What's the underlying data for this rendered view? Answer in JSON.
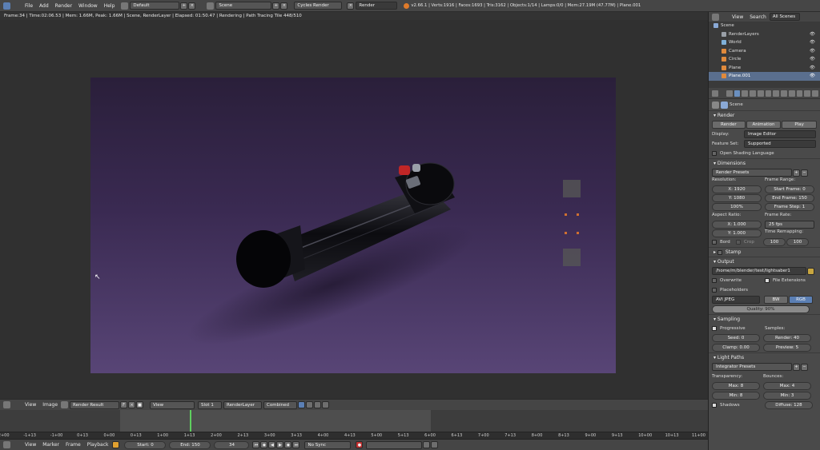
{
  "topbar": {
    "menus": [
      "File",
      "Add",
      "Render",
      "Window",
      "Help"
    ],
    "layout": "Default",
    "scene": "Scene",
    "engine": "Cycles Render",
    "render_tab": "Render",
    "stats": "v2.66.1 | Verts:1916 | Faces:1693 | Tris:3162 | Objects:1/14 | Lamps:0/0 | Mem:27.19M (47.77M) | Plane.001"
  },
  "infobar": {
    "text": "Frame:34 | Time:02:06.53 | Mem: 1.66M, Peak: 1.66M | Scene, RenderLayer | Elapsed: 01:50.47 | Rendering | Path Tracing Tile 448/510"
  },
  "image_header": {
    "view": "View",
    "image": "Image",
    "image_name": "Render Result",
    "f": "F",
    "display": "View",
    "slot": "Slot 1",
    "layer": "RenderLayer",
    "pass": "Combined"
  },
  "timeline": {
    "ticks": [
      "-2+00",
      "-1+13",
      "-1+00",
      "0+13",
      "0+00",
      "0+13",
      "1+00",
      "1+13",
      "2+00",
      "2+13",
      "3+00",
      "3+13",
      "4+00",
      "4+13",
      "5+00",
      "5+13",
      "6+00",
      "6+13",
      "7+00",
      "7+13",
      "8+00",
      "8+13",
      "9+00",
      "9+13",
      "10+00",
      "10+13",
      "11+00"
    ],
    "view": "View",
    "marker": "Marker",
    "frame": "Frame",
    "playback": "Playback",
    "start": "Start: 0",
    "end": "End: 150",
    "current": "34",
    "sync": "No Sync"
  },
  "outliner": {
    "view": "View",
    "search": "Search",
    "filter": "All Scenes",
    "items": [
      {
        "label": "Scene",
        "color": "#8aa9d6",
        "indent": 0
      },
      {
        "label": "RenderLayers",
        "color": "#9aa0a8",
        "indent": 1
      },
      {
        "label": "World",
        "color": "#7fb0d8",
        "indent": 1
      },
      {
        "label": "Camera",
        "color": "#e08a3c",
        "indent": 1
      },
      {
        "label": "Circle",
        "color": "#e08a3c",
        "indent": 1
      },
      {
        "label": "Plane",
        "color": "#e08a3c",
        "indent": 1
      },
      {
        "label": "Plane.001",
        "color": "#e08a3c",
        "indent": 1,
        "selected": true
      }
    ]
  },
  "props": {
    "scene": "Scene",
    "render": {
      "title": "Render",
      "render_btn": "Render",
      "anim_btn": "Animation",
      "play_btn": "Play",
      "display_label": "Display:",
      "display": "Image Editor",
      "feature_label": "Feature Set:",
      "feature": "Supported",
      "osl": "Open Shading Language"
    },
    "dimensions": {
      "title": "Dimensions",
      "presets": "Render Presets",
      "resolution": "Resolution:",
      "x": "X: 1920",
      "y": "Y: 1080",
      "pct": "100%",
      "frame_range": "Frame Range:",
      "start": "Start Frame: 0",
      "end": "End Frame: 150",
      "step": "Frame Step: 1",
      "aspect": "Aspect Ratio:",
      "ax": "X: 1.000",
      "ay": "Y: 1.000",
      "frame_rate": "Frame Rate:",
      "fps": "25 fps",
      "remap": "Time Remapping:",
      "r1": "100",
      "r2": "100",
      "bord": "Bord",
      "crop": "Crop"
    },
    "stamp": "Stamp",
    "output": {
      "title": "Output",
      "path": "/home/m/blender/test/lightsaber1",
      "overwrite": "Overwrite",
      "ext": "File Extensions",
      "placeholders": "Placeholders",
      "format": "AVI JPEG",
      "bw": "BW",
      "rgb": "RGB",
      "quality": "Quality: 90%"
    },
    "sampling": {
      "title": "Sampling",
      "progressive": "Progressive",
      "samples": "Samples:",
      "seed": "Seed: 0",
      "clamp": "Clamp: 0.00",
      "render": "Render: 40",
      "preview": "Preview: 5"
    },
    "light": {
      "title": "Light Paths",
      "presets": "Integrator Presets",
      "transparency": "Transparency:",
      "bounces": "Bounces:",
      "tmax": "Max: 8",
      "tmin": "Min: 8",
      "bmax": "Max: 4",
      "bmin": "Min: 3",
      "shadows": "Shadows",
      "diffuse": "Diffuse: 128"
    }
  }
}
